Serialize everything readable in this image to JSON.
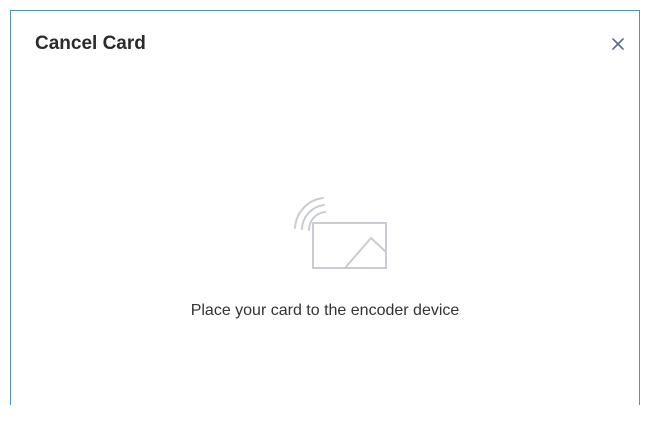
{
  "dialog": {
    "title": "Cancel Card",
    "close_icon": "close-icon",
    "illustration_icon": "card-tap-icon",
    "instruction": "Place your card to the encoder device"
  },
  "colors": {
    "frame_border": "#4a90d9",
    "title_text": "#2b2b2b",
    "close_icon": "#5b6b88",
    "illustration": "#c9ccd3",
    "body_text": "#333333"
  }
}
